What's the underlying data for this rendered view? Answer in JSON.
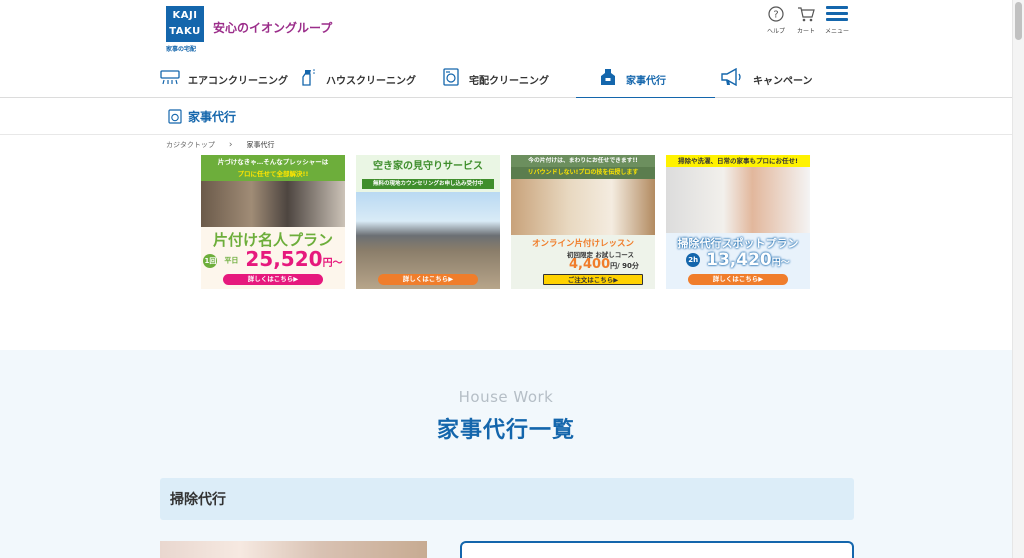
{
  "header": {
    "logo_line1": "KAJI",
    "logo_line2": "TAKU",
    "logo_sub": "家事の宅配",
    "tagline": "安心のイオングループ",
    "help_label": "ヘルプ",
    "cart_label": "カート",
    "menu_label": "メニュー"
  },
  "nav": [
    {
      "label": "エアコンクリーニング",
      "icon": "air-conditioner-icon"
    },
    {
      "label": "ハウスクリーニング",
      "icon": "spray-bottle-icon"
    },
    {
      "label": "宅配クリーニング",
      "icon": "washing-machine-icon"
    },
    {
      "label": "家事代行",
      "icon": "apron-icon"
    },
    {
      "label": "キャンペーン",
      "icon": "megaphone-icon"
    }
  ],
  "section": {
    "title": "家事代行",
    "icon": "washing-machine-icon"
  },
  "breadcrumb": {
    "home": "カジタクトップ",
    "current": "家事代行"
  },
  "banners": [
    {
      "top": "片づけなきゃ…そんなプレッシャーは",
      "top2": "プロに任せて全部解決!!",
      "title": "片付け名人プラン",
      "badge": "1回",
      "price_prefix": "平日",
      "price": "25,520",
      "price_unit": "円〜",
      "button": "詳しくはこちら▶"
    },
    {
      "top": "空き家の見守りサービス",
      "sub": "無料の現地カウンセリングお申し込み受付中",
      "button": "詳しくはこちら▶"
    },
    {
      "top": "今の片付けは、まわりにお任せできます!!",
      "sub": "リバウンドしない!プロの技を伝授します",
      "title": "オンライン片付けレッスン",
      "course": "初回限定 お試しコース",
      "price": "4,400",
      "price_unit": "円",
      "duration": "/ 90分",
      "button": "ご注文はこちら▶"
    },
    {
      "top": "掃除や洗濯、日常の家事もプロにお任せ!",
      "title": "掃除代行スポットプラン",
      "badge": "2h",
      "price": "13,420",
      "price_unit": "円〜",
      "button": "詳しくはこちら▶"
    }
  ],
  "lower": {
    "en_title": "House Work",
    "jp_title": "家事代行一覧",
    "category": "掃除代行"
  },
  "colors": {
    "brand": "#1466ac",
    "accent": "#9b2d8a",
    "pink": "#e6197d"
  }
}
